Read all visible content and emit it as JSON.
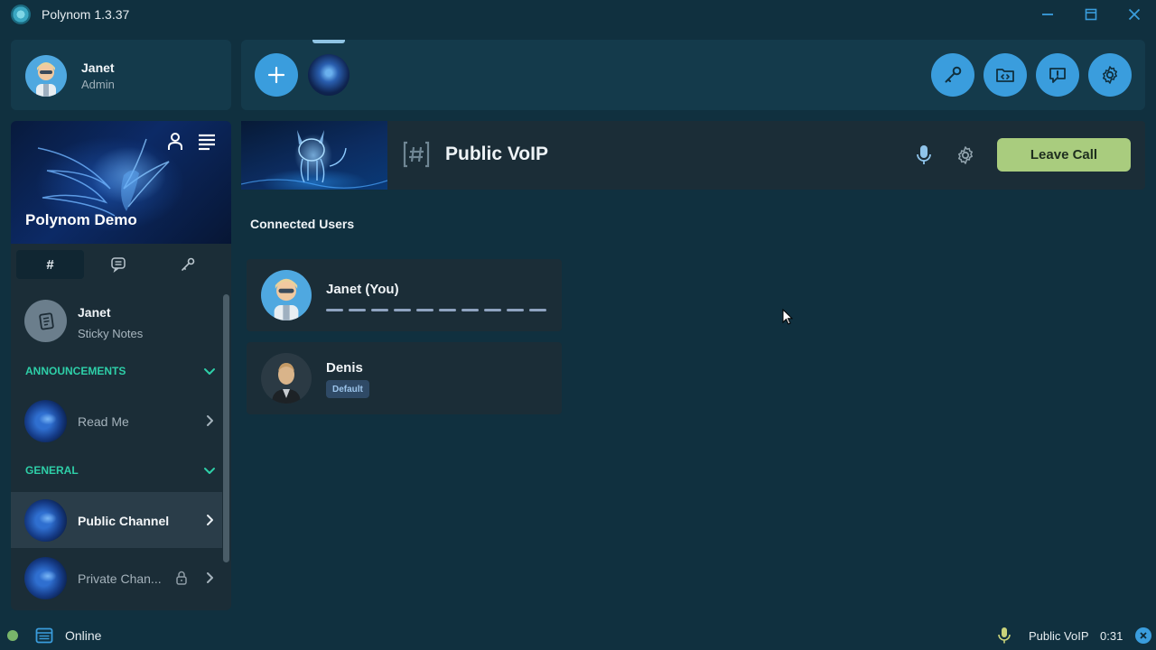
{
  "window": {
    "title": "Polynom 1.3.37"
  },
  "current_user": {
    "name": "Janet",
    "role": "Admin"
  },
  "server": {
    "name": "Polynom Demo"
  },
  "tabs": {
    "channels": "#"
  },
  "sticky_notes": {
    "name": "Janet",
    "subtitle": "Sticky Notes"
  },
  "categories": {
    "announcements": "ANNOUNCEMENTS",
    "general": "GENERAL"
  },
  "channels": {
    "read_me": "Read Me",
    "public": "Public Channel",
    "private": "Private Chan..."
  },
  "channel_header": {
    "title": "Public VoIP",
    "leave_label": "Leave Call"
  },
  "call": {
    "heading": "Connected Users",
    "users": [
      {
        "name": "Janet (You)"
      },
      {
        "name": "Denis",
        "badge": "Default"
      }
    ]
  },
  "status_bar": {
    "status": "Online",
    "channel": "Public VoIP",
    "timer": "0:31"
  },
  "colors": {
    "accent": "#3a9ddd",
    "category": "#2ecfa8",
    "leave_button": "#a9cc7e",
    "online": "#79b56a"
  }
}
